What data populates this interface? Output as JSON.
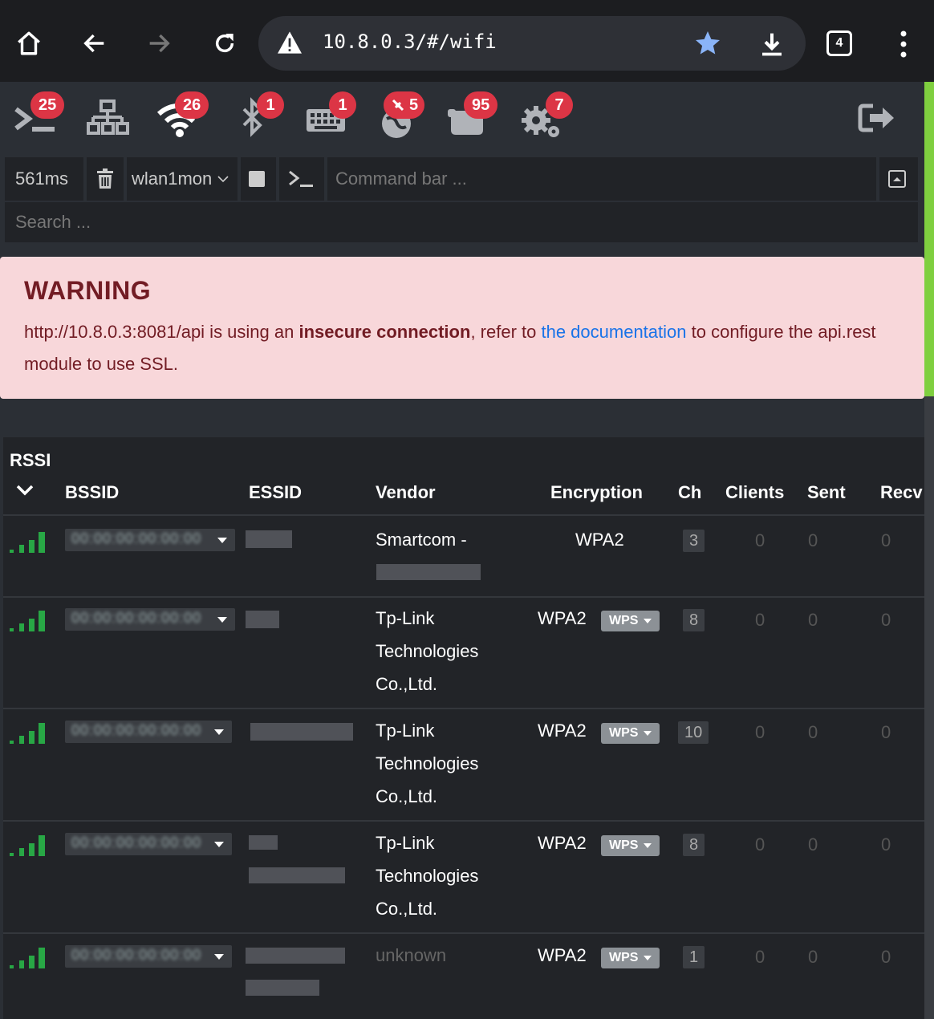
{
  "browser": {
    "url": "10.8.0.3/#/wifi",
    "tab_count": "4"
  },
  "nav": {
    "badges": [
      "25",
      "26",
      "1",
      "1",
      "5",
      "95",
      "7"
    ]
  },
  "cmdbar": {
    "latency": "561ms",
    "interface": "wlan1mon",
    "command_placeholder": "Command bar ...",
    "search_placeholder": "Search ..."
  },
  "warning": {
    "title": "WARNING",
    "text_pre": "http://10.8.0.3:8081/api is using an ",
    "text_bold": "insecure connection",
    "text_mid": ", refer to ",
    "link": "the documentation",
    "text_post": " to configure the api.rest module to use SSL."
  },
  "table": {
    "headers": {
      "rssi": "RSSI",
      "bssid": "BSSID",
      "essid": "ESSID",
      "vendor": "Vendor",
      "encryption": "Encryption",
      "ch": "Ch",
      "clients": "Clients",
      "sent": "Sent",
      "recv": "Recv"
    },
    "rows": [
      {
        "vendor1": "Smartcom -",
        "vendor2": "",
        "vendor3": "",
        "encryption": "WPA2",
        "wps": "",
        "ch": "3",
        "clients": "0",
        "sent": "0",
        "recv": "0"
      },
      {
        "vendor1": "Tp-Link",
        "vendor2": "Technologies",
        "vendor3": "Co.,Ltd.",
        "encryption": "WPA2",
        "wps": "WPS",
        "ch": "8",
        "clients": "0",
        "sent": "0",
        "recv": "0"
      },
      {
        "vendor1": "Tp-Link",
        "vendor2": "Technologies",
        "vendor3": "Co.,Ltd.",
        "encryption": "WPA2",
        "wps": "WPS",
        "ch": "10",
        "clients": "0",
        "sent": "0",
        "recv": "0"
      },
      {
        "vendor1": "Tp-Link",
        "vendor2": "Technologies",
        "vendor3": "Co.,Ltd.",
        "encryption": "WPA2",
        "wps": "WPS",
        "ch": "8",
        "clients": "0",
        "sent": "0",
        "recv": "0"
      },
      {
        "vendor1": "unknown",
        "vendor2": "",
        "vendor3": "",
        "encryption": "WPA2",
        "wps": "WPS",
        "ch": "1",
        "clients": "0",
        "sent": "0",
        "recv": "0"
      }
    ]
  }
}
